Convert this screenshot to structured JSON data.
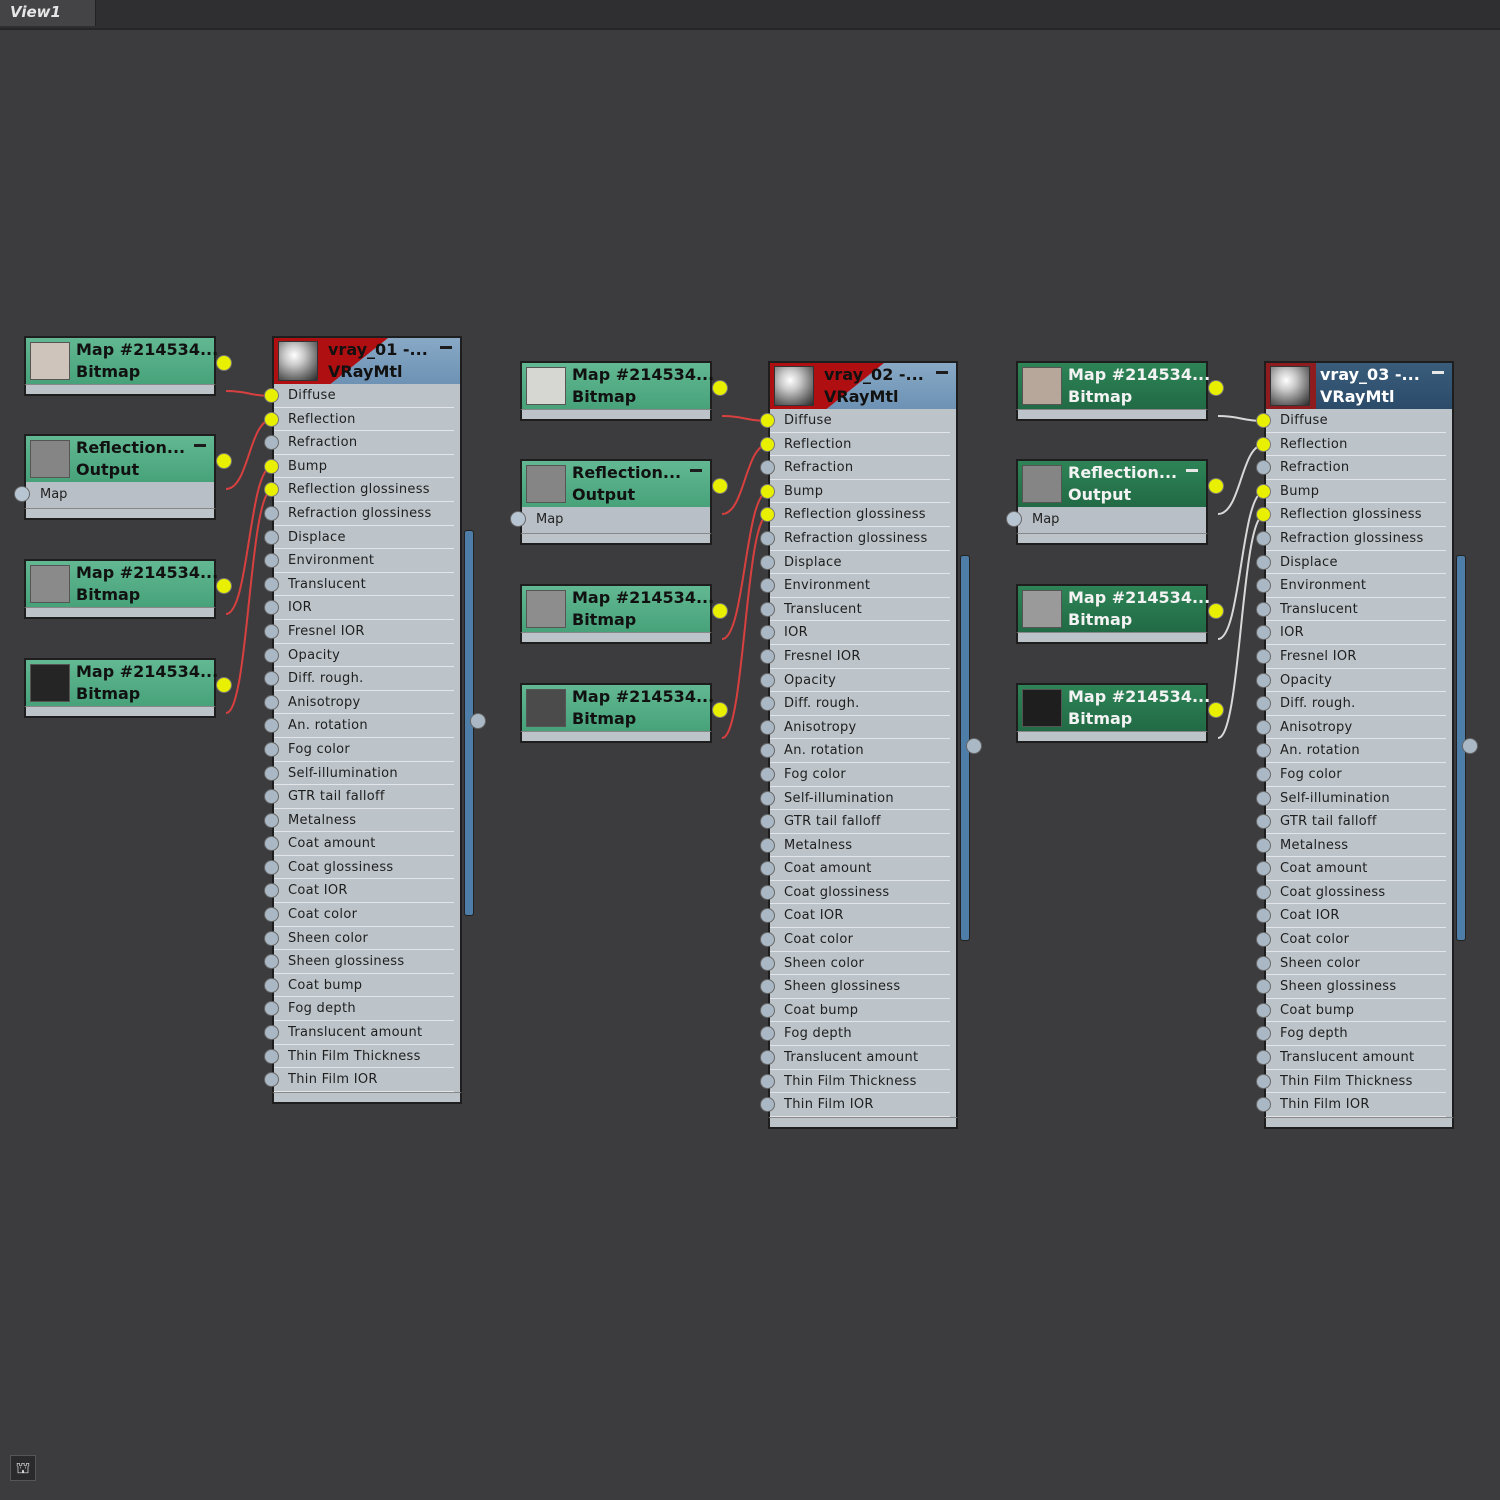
{
  "view": {
    "tab_label": "View1"
  },
  "colors": {
    "canvas": "#3c3c3e",
    "wire": "#d84040",
    "socket_connected": "#e8f000",
    "socket_idle": "#aab8c5",
    "map_node_light": "#52aa82",
    "map_node_dark": "#2a7a4f",
    "material_header": "#6d92b4",
    "material_header_dark": "#2b4b69",
    "material_highlight": "#b00f12"
  },
  "groups": [
    {
      "material": {
        "name": "vray_01 -...",
        "type": "VRayMtl",
        "selected": true
      },
      "maps": [
        {
          "title": "Map #214534...",
          "subtitle": "Bitmap",
          "swatch": "#cfc4bc",
          "target": "Diffuse"
        },
        {
          "title": "Reflection...",
          "subtitle": "Output",
          "swatch": "#858585",
          "slot_label": "Map",
          "target": "Reflection"
        },
        {
          "title": "Map #214534...",
          "subtitle": "Bitmap",
          "swatch": "#8a8a8a",
          "target": "Bump"
        },
        {
          "title": "Map #214534...",
          "subtitle": "Bitmap",
          "swatch": "#252525",
          "target": "Reflection glossiness"
        }
      ]
    },
    {
      "material": {
        "name": "vray_02 -...",
        "type": "VRayMtl",
        "selected": true
      },
      "maps": [
        {
          "title": "Map #214534...",
          "subtitle": "Bitmap",
          "swatch": "#d6d6d2",
          "target": "Diffuse"
        },
        {
          "title": "Reflection...",
          "subtitle": "Output",
          "swatch": "#858585",
          "slot_label": "Map",
          "target": "Reflection"
        },
        {
          "title": "Map #214534...",
          "subtitle": "Bitmap",
          "swatch": "#8d8d8d",
          "target": "Bump"
        },
        {
          "title": "Map #214534...",
          "subtitle": "Bitmap",
          "swatch": "#4b4b4b",
          "target": "Reflection glossiness"
        }
      ]
    },
    {
      "material": {
        "name": "vray_03 -...",
        "type": "VRayMtl",
        "selected": false
      },
      "maps": [
        {
          "title": "Map #214534...",
          "subtitle": "Bitmap",
          "swatch": "#b7a69a",
          "target": "Diffuse"
        },
        {
          "title": "Reflection...",
          "subtitle": "Output",
          "swatch": "#858585",
          "slot_label": "Map",
          "target": "Reflection"
        },
        {
          "title": "Map #214534...",
          "subtitle": "Bitmap",
          "swatch": "#9a9a9a",
          "target": "Bump"
        },
        {
          "title": "Map #214534...",
          "subtitle": "Bitmap",
          "swatch": "#1e1e1e",
          "target": "Reflection glossiness"
        }
      ]
    }
  ],
  "slots": [
    "Diffuse",
    "Reflection",
    "Refraction",
    "Bump",
    "Reflection glossiness",
    "Refraction glossiness",
    "Displace",
    "Environment",
    "Translucent",
    "IOR",
    "Fresnel IOR",
    "Opacity",
    "Diff. rough.",
    "Anisotropy",
    "An. rotation",
    "Fog color",
    "Self-illumination",
    "GTR tail falloff",
    "Metalness",
    "Coat amount",
    "Coat glossiness",
    "Coat IOR",
    "Coat color",
    "Sheen color",
    "Sheen glossiness",
    "Coat bump",
    "Fog depth",
    "Translucent amount",
    "Thin Film Thickness",
    "Thin Film IOR"
  ],
  "connected_slots": [
    "Diffuse",
    "Reflection",
    "Bump",
    "Reflection glossiness"
  ],
  "bottom_icon": "node-tree-icon"
}
